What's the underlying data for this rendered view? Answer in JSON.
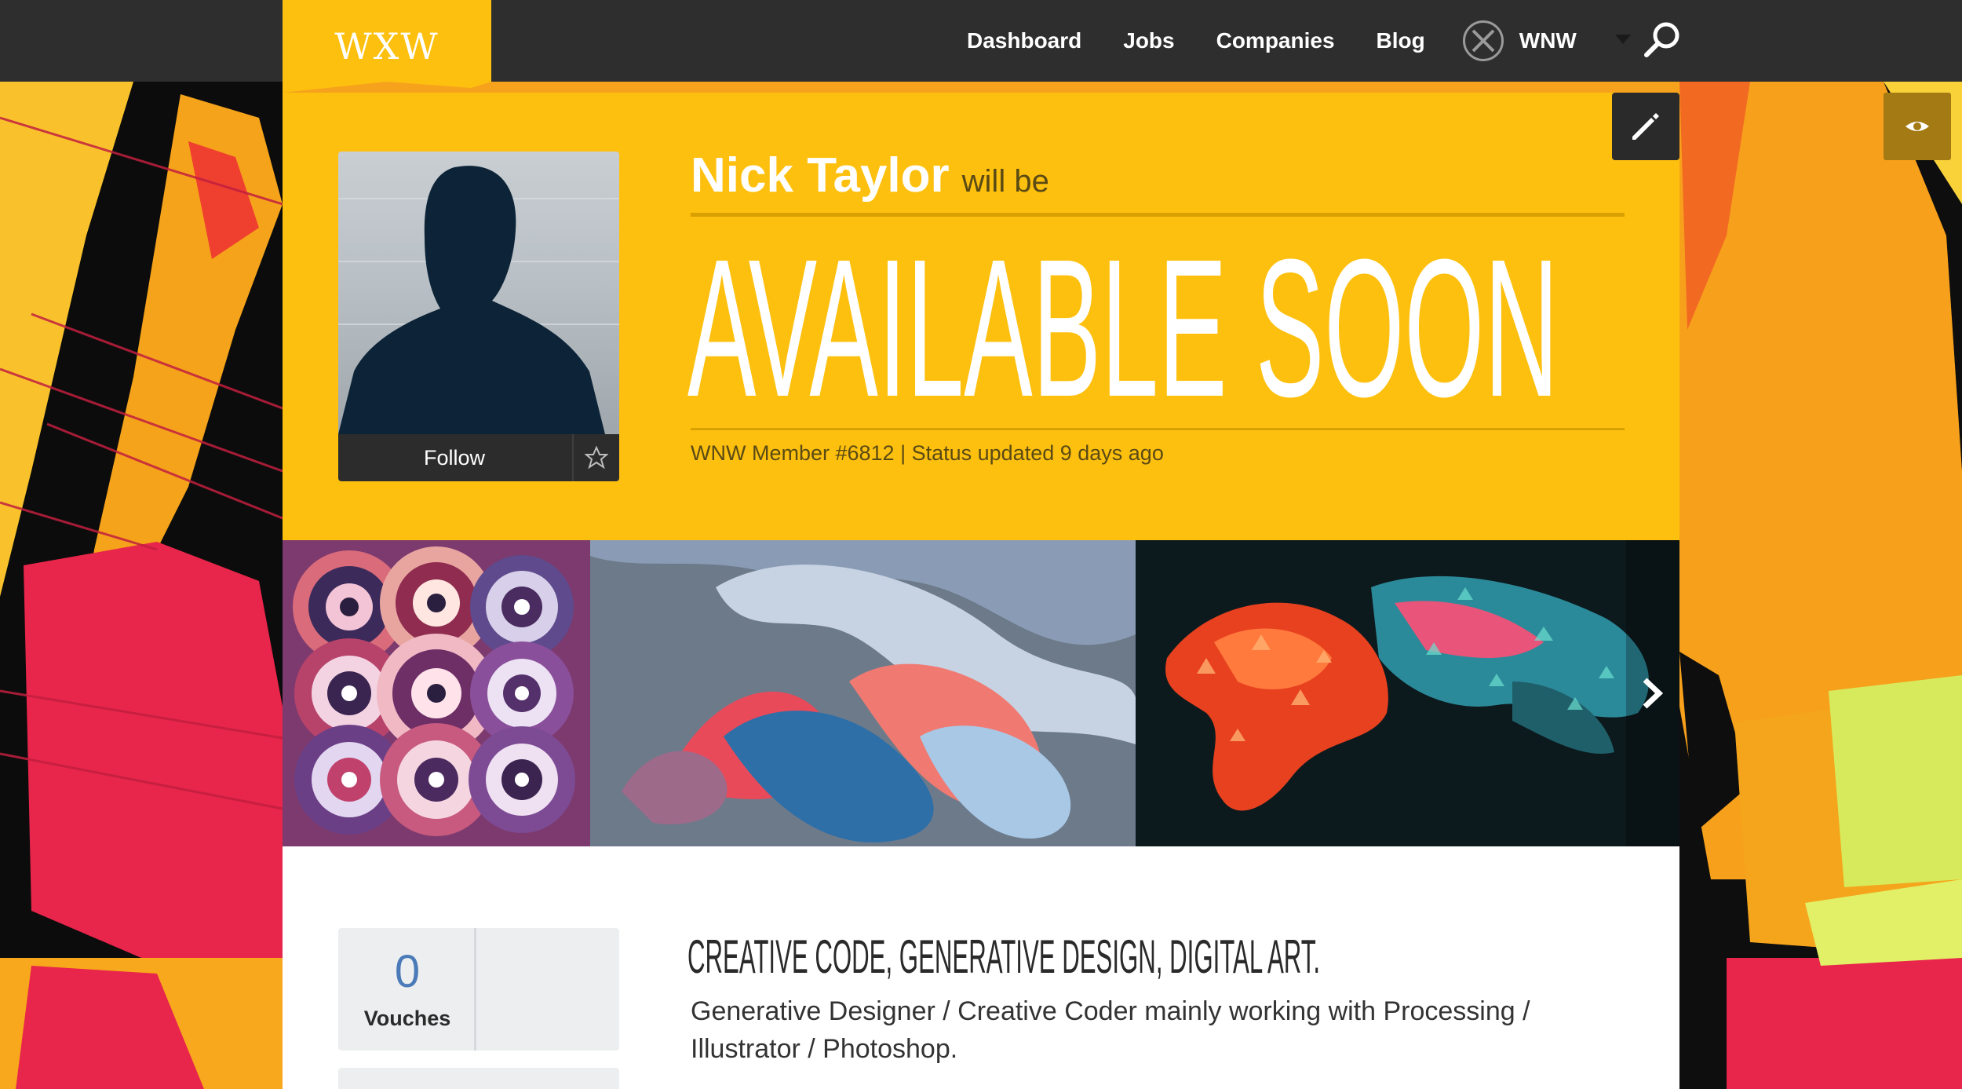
{
  "nav": {
    "logo_text": "WXW",
    "links": [
      "Dashboard",
      "Jobs",
      "Companies",
      "Blog"
    ],
    "user_label": "WNW"
  },
  "profile": {
    "name": "Nick Taylor",
    "will_be": "will be",
    "status": "AVAILABLE SOON",
    "member_line": "WNW Member #6812 | Status updated 9 days ago",
    "follow_label": "Follow"
  },
  "stats": {
    "vouches_count": "0",
    "vouches_label": "Vouches"
  },
  "about": {
    "headline": "CREATIVE CODE, GENERATIVE DESIGN, DIGITAL ART.",
    "bio": "Generative Designer / Creative Coder mainly working with Processing / Illustrator / Photoshop."
  },
  "colors": {
    "accent_yellow": "#fec00f",
    "nav_bg": "#2e2e2e",
    "vouch_blue": "#4a7ab8"
  },
  "icons": {
    "edit": "pencil-icon",
    "preview": "eye-icon",
    "search": "search-icon",
    "favorite": "star-icon",
    "next": "chevron-right-icon",
    "menu": "caret-down-icon"
  }
}
